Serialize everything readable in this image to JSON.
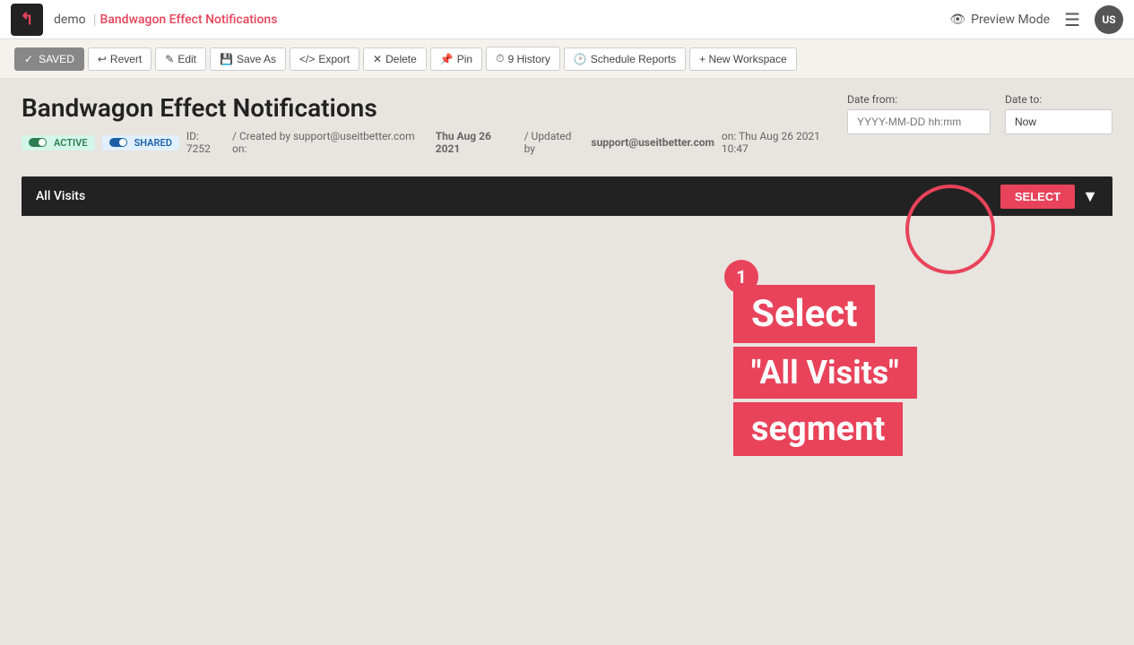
{
  "nav": {
    "logo_icon": "↖",
    "demo_label": "demo",
    "title": "Bandwagon Effect Notifications",
    "preview_mode_label": "Preview Mode",
    "avatar_initials": "US"
  },
  "toolbar": {
    "saved_label": "SAVED",
    "revert_label": "Revert",
    "edit_label": "Edit",
    "save_as_label": "Save As",
    "export_label": "Export",
    "delete_label": "Delete",
    "pin_label": "Pin",
    "history_label": "9 History",
    "schedule_reports_label": "Schedule Reports",
    "new_workspace_label": "+ New Workspace"
  },
  "report": {
    "title": "Bandwagon Effect Notifications",
    "active_badge": "ACTIVE",
    "shared_badge": "SHARED",
    "id_text": "ID: 7252",
    "created_text": "/ Created by support@useitbetter.com on:",
    "created_date": "Thu Aug 26 2021",
    "updated_text": "/ Updated by",
    "updated_by": "support@useitbetter.com",
    "updated_on": "on: Thu Aug 26 2021 10:47"
  },
  "date_range": {
    "from_label": "Date from:",
    "to_label": "Date to:",
    "from_placeholder": "YYYY-MM-DD hh:mm",
    "to_value": "Now"
  },
  "segment": {
    "name": "All Visits",
    "select_label": "SELECT"
  },
  "annotation": {
    "step_number": "1",
    "line1": "Select",
    "line2": "\"All Visits\"",
    "line3": "segment"
  }
}
